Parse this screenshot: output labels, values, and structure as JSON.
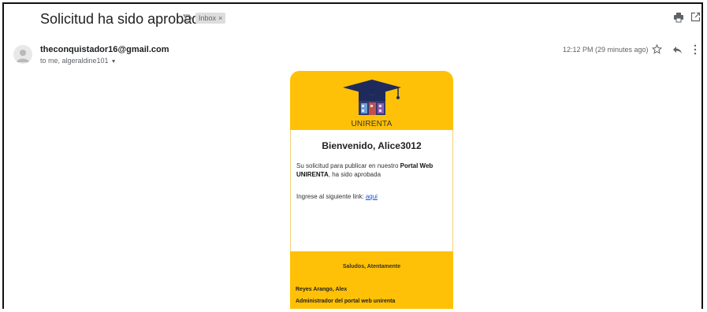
{
  "email": {
    "subject": "Solicitud ha sido aprobada",
    "label": "Inbox",
    "label_close": "×",
    "sender": "theconquistador16@gmail.com",
    "recipients": "to me, algeraldine101",
    "timestamp": "12:12 PM (29 minutes ago)"
  },
  "icons": {
    "important": "important-marker-icon",
    "print": "print-icon",
    "popout": "open-in-new-window-icon",
    "avatar": "person-avatar-icon",
    "star": "star-icon",
    "reply": "reply-icon",
    "more": "more-vertical-icon",
    "logo": "graduation-cap-house-logo"
  },
  "card": {
    "brand": "UNIRENTA",
    "welcome": "Bienvenido, Alice3012",
    "message_prefix": "Su solicitud para publicar en nuestro ",
    "message_bold": "Portal Web UNIRENTA",
    "message_suffix": ", ha sido aprobada",
    "link_prefix": "Ingrese al siguiente link:",
    "link_text": "aqui",
    "regards": "Saludos, Atentamente",
    "signature_name": "Reyes Arango, Alex",
    "signature_role": "Administrador del portal web unirenta"
  },
  "colors": {
    "brand_yellow": "#ffc107",
    "link_blue": "#1a56d6",
    "cap_navy": "#1f2a5c"
  }
}
